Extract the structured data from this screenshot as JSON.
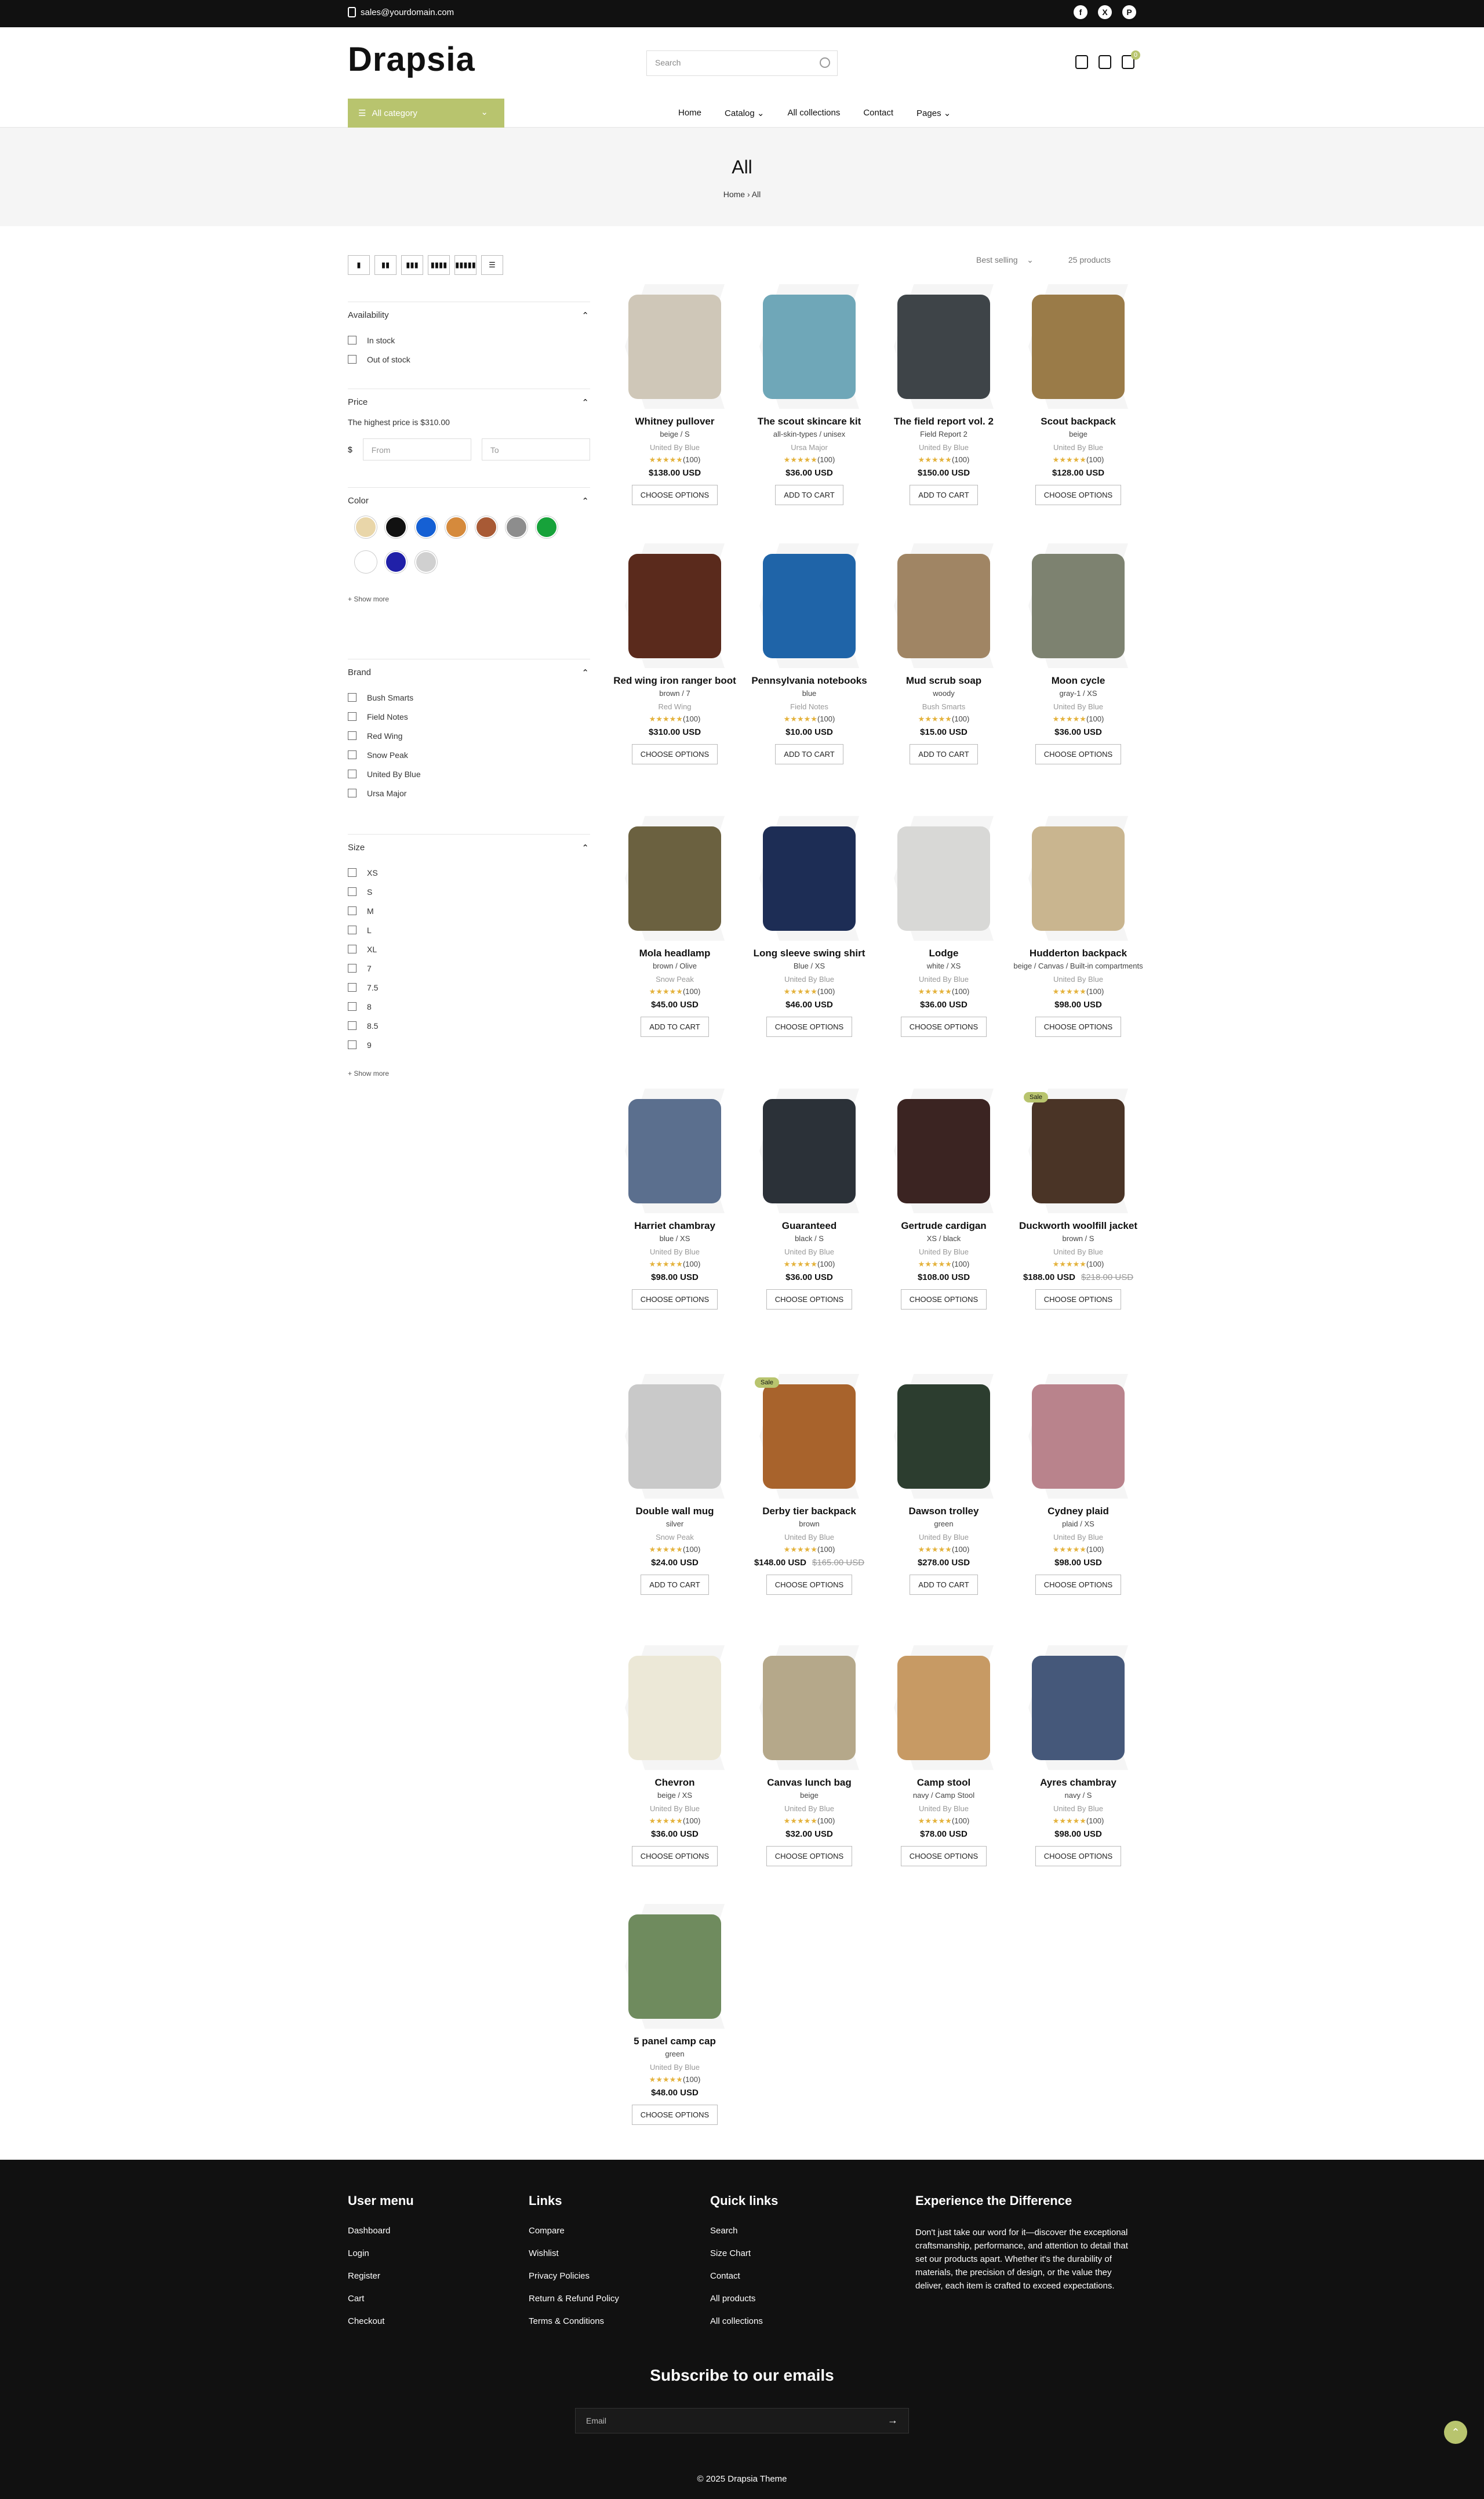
{
  "topbar": {
    "email": "sales@yourdomain.com",
    "social": [
      {
        "icon": "facebook-icon",
        "glyph": "f"
      },
      {
        "icon": "x-icon",
        "glyph": "X"
      },
      {
        "icon": "pinterest-icon",
        "glyph": "P"
      }
    ]
  },
  "header": {
    "logo": "Drapsia",
    "search_placeholder": "Search",
    "cart_count": "0"
  },
  "nav": {
    "all_category": "All category",
    "items": [
      "Home",
      "Catalog",
      "All collections",
      "Contact",
      "Pages"
    ]
  },
  "banner": {
    "title": "All",
    "breadcrumb": "Home › All"
  },
  "toolbar": {
    "sort": "Best selling",
    "count": "25 products",
    "view_icons": [
      "▮",
      "▮▮",
      "▮▮▮",
      "▮▮▮▮",
      "▮▮▮▮▮",
      "☰"
    ]
  },
  "filters": {
    "availability": {
      "title": "Availability",
      "options": [
        "In stock",
        "Out of stock"
      ]
    },
    "price": {
      "title": "Price",
      "note": "The highest price is $310.00",
      "currency": "$",
      "from": "From",
      "to": "To"
    },
    "color": {
      "title": "Color",
      "swatches": [
        "#e9d6a9",
        "#111111",
        "#1560d4",
        "#d58a3c",
        "#a85a35",
        "#8d8d8d",
        "#17a23a",
        "#ffffff",
        "#2020a8",
        "#d0d0d0"
      ],
      "show_more": "+ Show more"
    },
    "brand": {
      "title": "Brand",
      "options": [
        "Bush Smarts",
        "Field Notes",
        "Red Wing",
        "Snow Peak",
        "United By Blue",
        "Ursa Major"
      ]
    },
    "size": {
      "title": "Size",
      "options": [
        "XS",
        "S",
        "M",
        "L",
        "XL",
        "7",
        "7.5",
        "8",
        "8.5",
        "9"
      ],
      "show_more": "+ Show more"
    }
  },
  "products": [
    {
      "name": "Whitney pullover",
      "variant": "beige / S",
      "vendor": "United By Blue",
      "reviews": "(100)",
      "price": "$138.00 USD",
      "button": "CHOOSE OPTIONS",
      "color": "#cfc7b8"
    },
    {
      "name": "The scout skincare kit",
      "variant": "all-skin-types / unisex",
      "vendor": "Ursa Major",
      "reviews": "(100)",
      "price": "$36.00 USD",
      "button": "ADD TO CART",
      "color": "#6fa7b8"
    },
    {
      "name": "The field report vol. 2",
      "variant": "Field Report 2",
      "vendor": "United By Blue",
      "reviews": "(100)",
      "price": "$150.00 USD",
      "button": "ADD TO CART",
      "color": "#3e4448"
    },
    {
      "name": "Scout backpack",
      "variant": "beige",
      "vendor": "United By Blue",
      "reviews": "(100)",
      "price": "$128.00 USD",
      "button": "CHOOSE OPTIONS",
      "color": "#9a7b48"
    },
    {
      "name": "Red wing iron ranger boot",
      "variant": "brown / 7",
      "vendor": "Red Wing",
      "reviews": "(100)",
      "price": "$310.00 USD",
      "button": "CHOOSE OPTIONS",
      "color": "#5a2a1c"
    },
    {
      "name": "Pennsylvania notebooks",
      "variant": "blue",
      "vendor": "Field Notes",
      "reviews": "(100)",
      "price": "$10.00 USD",
      "button": "ADD TO CART",
      "color": "#1f64a8"
    },
    {
      "name": "Mud scrub soap",
      "variant": "woody",
      "vendor": "Bush Smarts",
      "reviews": "(100)",
      "price": "$15.00 USD",
      "button": "ADD TO CART",
      "color": "#a08564"
    },
    {
      "name": "Moon cycle",
      "variant": "gray-1 / XS",
      "vendor": "United By Blue",
      "reviews": "(100)",
      "price": "$36.00 USD",
      "button": "CHOOSE OPTIONS",
      "color": "#7d8270"
    },
    {
      "name": "Mola headlamp",
      "variant": "brown / Olive",
      "vendor": "Snow Peak",
      "reviews": "(100)",
      "price": "$45.00 USD",
      "button": "ADD TO CART",
      "color": "#6b6140"
    },
    {
      "name": "Long sleeve swing shirt",
      "variant": "Blue / XS",
      "vendor": "United By Blue",
      "reviews": "(100)",
      "price": "$46.00 USD",
      "button": "CHOOSE OPTIONS",
      "color": "#1d2d55"
    },
    {
      "name": "Lodge",
      "variant": "white / XS",
      "vendor": "United By Blue",
      "reviews": "(100)",
      "price": "$36.00 USD",
      "button": "CHOOSE OPTIONS",
      "color": "#d8d8d6"
    },
    {
      "name": "Hudderton backpack",
      "variant": "beige / Canvas / Built-in compartments",
      "vendor": "United By Blue",
      "reviews": "(100)",
      "price": "$98.00 USD",
      "button": "CHOOSE OPTIONS",
      "color": "#c9b58f"
    },
    {
      "name": "Harriet chambray",
      "variant": "blue / XS",
      "vendor": "United By Blue",
      "reviews": "(100)",
      "price": "$98.00 USD",
      "button": "CHOOSE OPTIONS",
      "color": "#5b6f8e"
    },
    {
      "name": "Guaranteed",
      "variant": "black / S",
      "vendor": "United By Blue",
      "reviews": "(100)",
      "price": "$36.00 USD",
      "button": "CHOOSE OPTIONS",
      "color": "#2b3138"
    },
    {
      "name": "Gertrude cardigan",
      "variant": "XS / black",
      "vendor": "United By Blue",
      "reviews": "(100)",
      "price": "$108.00 USD",
      "button": "CHOOSE OPTIONS",
      "color": "#3b2422"
    },
    {
      "name": "Duckworth woolfill jacket",
      "variant": "brown / S",
      "vendor": "United By Blue",
      "reviews": "(100)",
      "price": "$188.00 USD",
      "old_price": "$218.00 USD",
      "sale": "Sale",
      "button": "CHOOSE OPTIONS",
      "color": "#4a3426"
    },
    {
      "name": "Double wall mug",
      "variant": "silver",
      "vendor": "Snow Peak",
      "reviews": "(100)",
      "price": "$24.00 USD",
      "button": "ADD TO CART",
      "color": "#c9c9c9"
    },
    {
      "name": "Derby tier backpack",
      "variant": "brown",
      "vendor": "United By Blue",
      "reviews": "(100)",
      "price": "$148.00 USD",
      "old_price": "$165.00 USD",
      "sale": "Sale",
      "button": "CHOOSE OPTIONS",
      "color": "#a8632c"
    },
    {
      "name": "Dawson trolley",
      "variant": "green",
      "vendor": "United By Blue",
      "reviews": "(100)",
      "price": "$278.00 USD",
      "button": "ADD TO CART",
      "color": "#2c3d2f"
    },
    {
      "name": "Cydney plaid",
      "variant": "plaid / XS",
      "vendor": "United By Blue",
      "reviews": "(100)",
      "price": "$98.00 USD",
      "button": "CHOOSE OPTIONS",
      "color": "#b9838c"
    },
    {
      "name": "Chevron",
      "variant": "beige / XS",
      "vendor": "United By Blue",
      "reviews": "(100)",
      "price": "$36.00 USD",
      "button": "CHOOSE OPTIONS",
      "color": "#ece8d7"
    },
    {
      "name": "Canvas lunch bag",
      "variant": "beige",
      "vendor": "United By Blue",
      "reviews": "(100)",
      "price": "$32.00 USD",
      "button": "CHOOSE OPTIONS",
      "color": "#b5a88a"
    },
    {
      "name": "Camp stool",
      "variant": "navy / Camp Stool",
      "vendor": "United By Blue",
      "reviews": "(100)",
      "price": "$78.00 USD",
      "button": "CHOOSE OPTIONS",
      "color": "#c79a64"
    },
    {
      "name": "Ayres chambray",
      "variant": "navy / S",
      "vendor": "United By Blue",
      "reviews": "(100)",
      "price": "$98.00 USD",
      "button": "CHOOSE OPTIONS",
      "color": "#45587a"
    },
    {
      "name": "5 panel camp cap",
      "variant": "green",
      "vendor": "United By Blue",
      "reviews": "(100)",
      "price": "$48.00 USD",
      "button": "CHOOSE OPTIONS",
      "color": "#6f8b5e"
    }
  ],
  "footer": {
    "cols": [
      {
        "title": "User menu",
        "links": [
          "Dashboard",
          "Login",
          "Register",
          "Cart",
          "Checkout"
        ]
      },
      {
        "title": "Links",
        "links": [
          "Compare",
          "Wishlist",
          "Privacy Policies",
          "Return & Refund Policy",
          "Terms & Conditions"
        ]
      },
      {
        "title": "Quick links",
        "links": [
          "Search",
          "Size Chart",
          "Contact",
          "All products",
          "All collections"
        ]
      }
    ],
    "experience": {
      "title": "Experience the Difference",
      "text": "Don't just take our word for it—discover the exceptional craftsmanship, performance, and attention to detail that set our products apart. Whether it's the durability of materials, the precision of design, or the value they deliver, each item is crafted to exceed expectations."
    },
    "subscribe": "Subscribe to our emails",
    "email_placeholder": "Email",
    "copyright": "© 2025  Drapsia Theme"
  }
}
